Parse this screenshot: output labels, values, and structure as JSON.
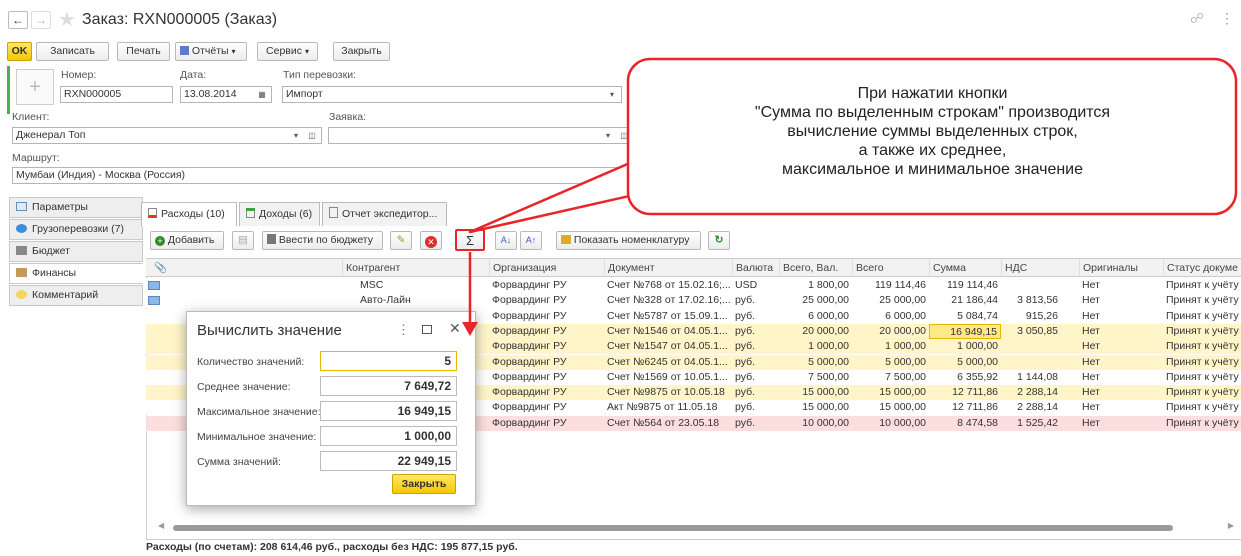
{
  "window": {
    "title": "Заказ: RXN000005 (Заказ)"
  },
  "toolbar": {
    "ok": "OK",
    "save": "Записать",
    "print": "Печать",
    "reports": "Отчёты",
    "service": "Сервис",
    "close": "Закрыть"
  },
  "form": {
    "number_label": "Номер:",
    "number_value": "RXN000005",
    "date_label": "Дата:",
    "date_value": "13.08.2014",
    "transport_label": "Тип перевозки:",
    "transport_value": "Импорт",
    "client_label": "Клиент:",
    "client_value": "Дженерал Топ",
    "request_label": "Заявка:",
    "request_value": "",
    "route_label": "Маршрут:",
    "route_value": "Мумбаи (Индия) - Москва (Россия)"
  },
  "callout": {
    "line1": "При нажатии кнопки",
    "line2": "\"Сумма по выделенным строкам\" производится",
    "line3": "вычисление суммы выделенных строк,",
    "line4": "а также их среднее,",
    "line5": "максимальное и минимальное значение"
  },
  "left_tabs": [
    "Параметры",
    "Грузоперевозки (7)",
    "Бюджет",
    "Финансы",
    "Комментарий"
  ],
  "finance_tabs": [
    "Расходы (10)",
    "Доходы (6)",
    "Отчет экспедитор..."
  ],
  "grid_toolbar": {
    "add": "Добавить",
    "budget": "Ввести по бюджету",
    "sigma": "Σ",
    "show_nomenclature": "Показать номенклатуру"
  },
  "grid": {
    "columns": [
      "Контрагент",
      "Организация",
      "Документ",
      "Валюта",
      "Всего, Вал.",
      "Всего",
      "Сумма",
      "НДС",
      "Оригиналы",
      "Статус докуме"
    ],
    "rows": [
      [
        "MSC",
        "Форвардинг РУ",
        "Счет №768 от 15.02.16;...",
        "USD",
        "1 800,00",
        "119 114,46",
        "119 114,46",
        "",
        "Нет",
        "Принят к учёту"
      ],
      [
        "Авто-Лайн",
        "Форвардинг РУ",
        "Счет №328 от 17.02.16;...",
        "руб.",
        "25 000,00",
        "25 000,00",
        "21 186,44",
        "3 813,56",
        "Нет",
        "Принят к учёту"
      ],
      [
        "",
        "Форвардинг РУ",
        "Счет №5787 от 15.09.1...",
        "руб.",
        "6 000,00",
        "6 000,00",
        "5 084,74",
        "915,26",
        "Нет",
        "Принят к учёту"
      ],
      [
        "",
        "Форвардинг РУ",
        "Счет №1546 от 04.05.1...",
        "руб.",
        "20 000,00",
        "20 000,00",
        "16 949,15",
        "3 050,85",
        "Нет",
        "Принят к учёту"
      ],
      [
        "",
        "Форвардинг РУ",
        "Счет №1547 от 04.05.1...",
        "руб.",
        "1 000,00",
        "1 000,00",
        "1 000,00",
        "",
        "Нет",
        "Принят к учёту"
      ],
      [
        "",
        "Форвардинг РУ",
        "Счет №6245 от 04.05.1...",
        "руб.",
        "5 000,00",
        "5 000,00",
        "5 000,00",
        "",
        "Нет",
        "Принят к учёту"
      ],
      [
        "",
        "Форвардинг РУ",
        "Счет №1569 от 10.05.1...",
        "руб.",
        "7 500,00",
        "7 500,00",
        "6 355,92",
        "1 144,08",
        "Нет",
        "Принят к учёту"
      ],
      [
        "",
        "Форвардинг РУ",
        "Счет №9875 от 10.05.18",
        "руб.",
        "15 000,00",
        "15 000,00",
        "12 711,86",
        "2 288,14",
        "Нет",
        "Принят к учёту"
      ],
      [
        "",
        "Форвардинг РУ",
        "Акт №9875 от 11.05.18",
        "руб.",
        "15 000,00",
        "15 000,00",
        "12 711,86",
        "2 288,14",
        "Нет",
        "Принят к учёту"
      ],
      [
        "",
        "Форвардинг РУ",
        "Счет №564 от 23.05.18",
        "руб.",
        "10 000,00",
        "10 000,00",
        "8 474,58",
        "1 525,42",
        "Нет",
        "Принят к учёту"
      ]
    ]
  },
  "dialog": {
    "title": "Вычислить значение",
    "count_label": "Количество значений:",
    "count_value": "5",
    "avg_label": "Среднее значение:",
    "avg_value": "7 649,72",
    "max_label": "Максимальное значение:",
    "max_value": "16 949,15",
    "min_label": "Минимальное значение:",
    "min_value": "1 000,00",
    "sum_label": "Сумма значений:",
    "sum_value": "22 949,15",
    "close": "Закрыть"
  },
  "footer": {
    "summary": "Расходы (по счетам): 208 614,46 руб., расходы без НДС: 195 877,15 руб."
  },
  "colors": {
    "accent_yellow": "#f5c700",
    "callout_red": "#e8262a",
    "row_yellow": "#fff5c8",
    "row_pink": "#fcdede",
    "green_bar": "#4caf50"
  }
}
